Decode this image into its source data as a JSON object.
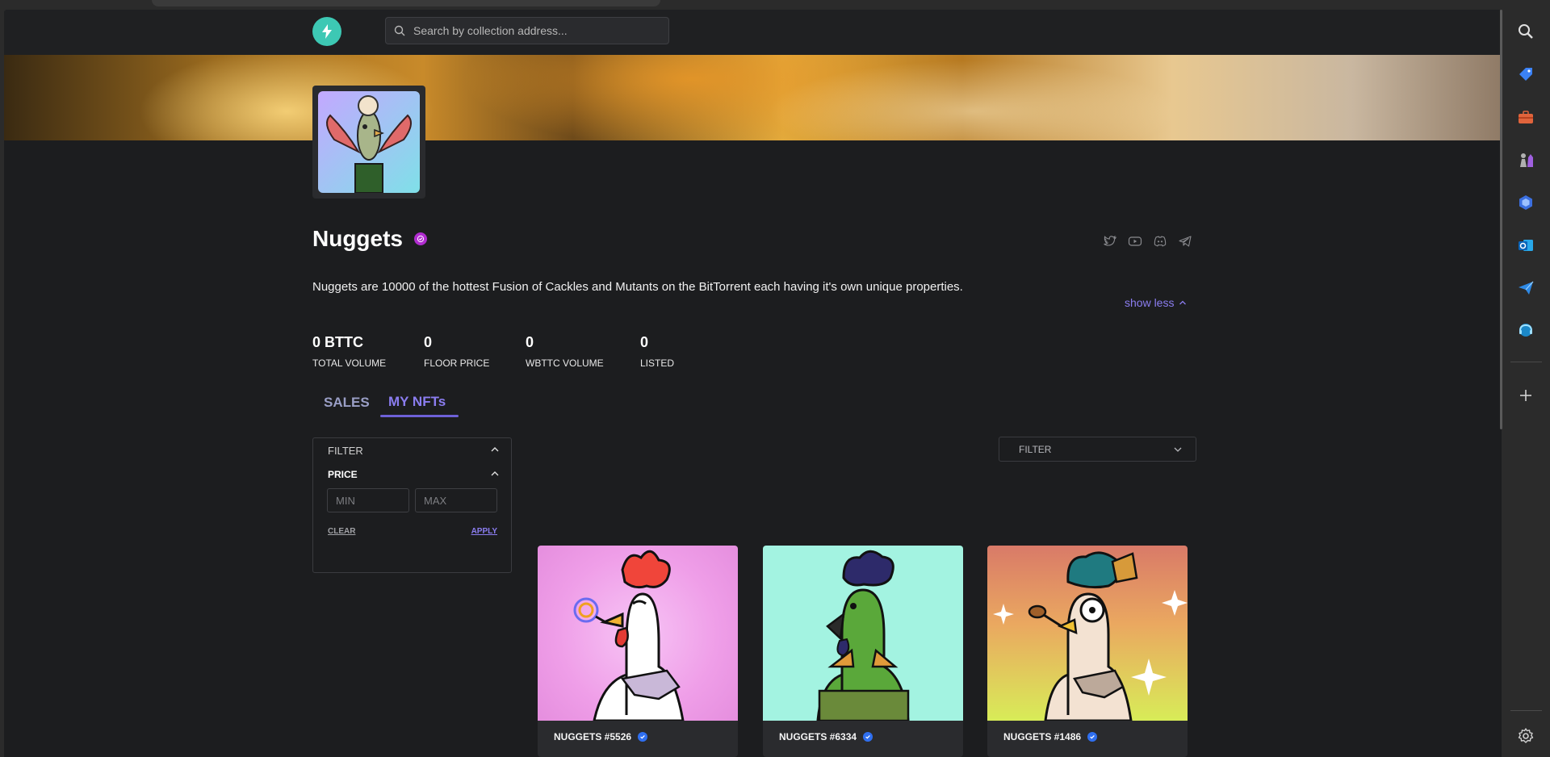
{
  "app": {
    "search_placeholder": "Search by collection address..."
  },
  "collection": {
    "title": "Nuggets",
    "description": "Nuggets are 10000 of the hottest Fusion of Cackles and Mutants on the BitTorrent each having it's own unique properties.",
    "show_less": "show less"
  },
  "socials": [
    "twitter-icon",
    "youtube-icon",
    "discord-icon",
    "telegram-icon"
  ],
  "stats": [
    {
      "value": "0 BTTC",
      "label": "TOTAL VOLUME"
    },
    {
      "value": "0",
      "label": "FLOOR PRICE"
    },
    {
      "value": "0",
      "label": "WBTTC VOLUME"
    },
    {
      "value": "0",
      "label": "LISTED"
    }
  ],
  "tabs": {
    "sales": "SALES",
    "my_nfts": "MY NFTs",
    "active": "my_nfts"
  },
  "filter_panel": {
    "title": "FILTER",
    "price_label": "PRICE",
    "min_placeholder": "MIN",
    "max_placeholder": "MAX",
    "clear": "CLEAR",
    "apply": "APPLY"
  },
  "sort_filter": {
    "label": "FILTER"
  },
  "cards": [
    {
      "name": "NUGGETS #5526",
      "bg": "#f4a8f0"
    },
    {
      "name": "NUGGETS #6334",
      "bg": "#a3f3e1"
    },
    {
      "name": "NUGGETS #1486",
      "bg": "#e08a6c"
    }
  ],
  "colors": {
    "accent": "#8b7df0",
    "logo": "#3dc8b4",
    "verified": "#b02ccf",
    "card_verified": "#2f6ff0"
  },
  "right_sidebar": [
    "search-icon",
    "tag-icon",
    "toolbox-icon",
    "chess-icon",
    "copilot-icon",
    "outlook-icon",
    "send-icon",
    "headset-icon",
    "add-icon",
    "settings-icon"
  ]
}
